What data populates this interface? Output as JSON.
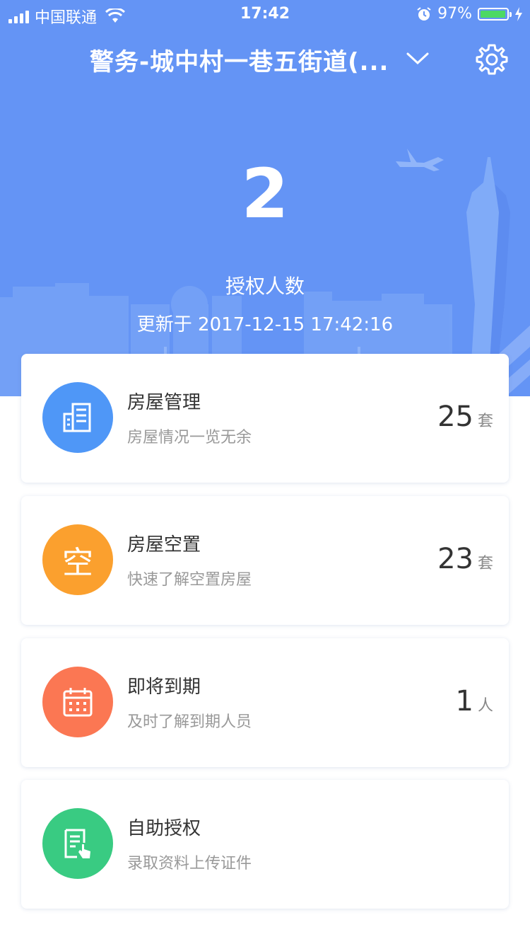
{
  "status_bar": {
    "carrier": "中国联通",
    "time": "17:42",
    "battery_percent": "97%",
    "battery_level": 0.97,
    "icons": [
      "signal-icon",
      "wifi-icon",
      "alarm-icon",
      "battery-icon",
      "charging-icon"
    ]
  },
  "header": {
    "title": "警务-城中村一巷五街道(...",
    "dropdown_icon": "chevron-down-icon",
    "settings_icon": "gear-icon",
    "stat_value": "2",
    "stat_label": "授权人数",
    "updated_text": "更新于 2017-12-15 17:42:16",
    "background_color": "#6494f5"
  },
  "cards": [
    {
      "title": "房屋管理",
      "subtitle": "房屋情况一览无余",
      "count": "25",
      "unit": "套",
      "icon": "building-icon",
      "color": "#4f97f7"
    },
    {
      "title": "房屋空置",
      "subtitle": "快速了解空置房屋",
      "count": "23",
      "unit": "套",
      "icon": "vacant-icon",
      "icon_text": "空",
      "color": "#fba02e"
    },
    {
      "title": "即将到期",
      "subtitle": "及时了解到期人员",
      "count": "1",
      "unit": "人",
      "icon": "calendar-icon",
      "color": "#fb7753"
    },
    {
      "title": "自助授权",
      "subtitle": "录取资料上传证件",
      "icon": "document-touch-icon",
      "color": "#39cb82"
    }
  ]
}
